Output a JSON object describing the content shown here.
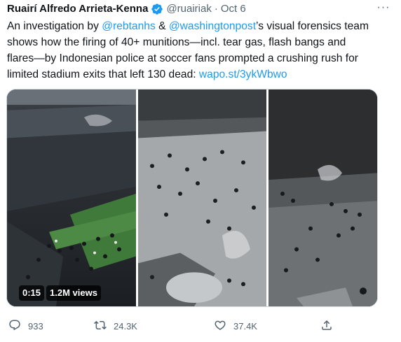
{
  "author": {
    "name": "Ruairí Alfredo Arrieta-Kenna",
    "handle": "@ruairiak",
    "separator": "·",
    "date": "Oct 6"
  },
  "tweet": {
    "line1_a": "An investigation by ",
    "mention1": "@rebtanhs",
    "line1_b": " & ",
    "mention2": "@washingtonpost",
    "line1_c": "’s visual forensics team",
    "line2": "shows how the firing of 40+ munitions—incl. tear gas, flash bangs and",
    "line3": "flares—by Indonesian police at soccer fans prompted a crushing rush for",
    "line4": "limited stadium exits that left 130 dead: ",
    "link": "wapo.st/3ykWbwo"
  },
  "more_label": "···",
  "media": {
    "duration": "0:15",
    "views": "1.2M views"
  },
  "actions": {
    "replies": "933",
    "retweets": "24.3K",
    "likes": "37.4K"
  },
  "colors": {
    "accent": "#1d9bf0",
    "text": "#0f1419",
    "muted": "#536471"
  }
}
